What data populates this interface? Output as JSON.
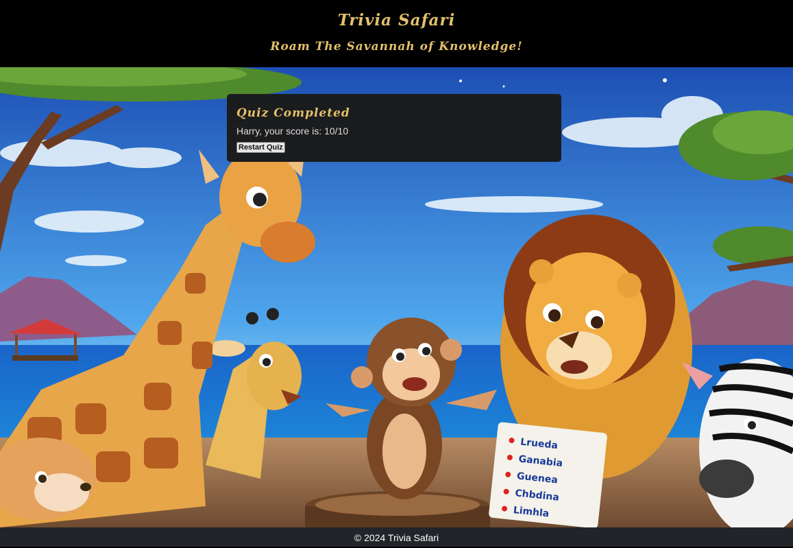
{
  "header": {
    "title": "Trivia Safari",
    "tagline": "Roam The Savannah of Knowledge!"
  },
  "quiz": {
    "heading": "Quiz Completed",
    "score_text": "Harry, your score is: 10/10",
    "restart_label": "Restart Quiz"
  },
  "scene": {
    "clipboard_lines": [
      "Lrueda",
      "Ganabia",
      "Guenea",
      "Chbdina",
      "Limhla"
    ]
  },
  "footer": {
    "copyright": "© 2024 Trivia Safari"
  },
  "colors": {
    "accent_gold": "#e2c06b",
    "card_bg": "#1b1c1e",
    "footer_bg": "#212529"
  }
}
